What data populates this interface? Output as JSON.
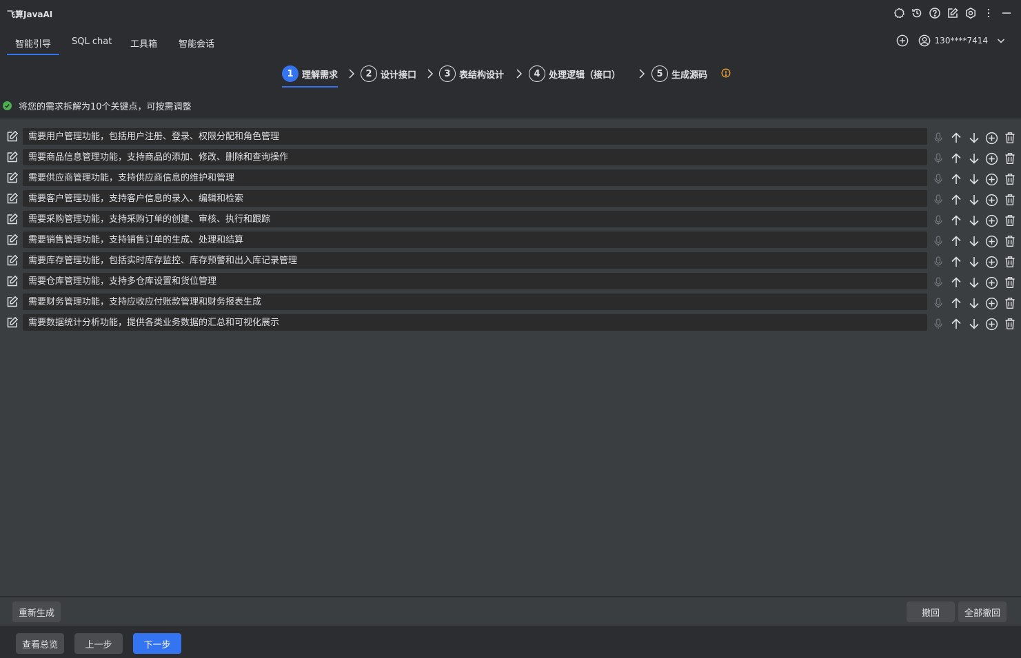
{
  "app": {
    "title": "飞算JavaAI"
  },
  "tabs": [
    {
      "label": "智能引导",
      "active": true
    },
    {
      "label": "SQL chat"
    },
    {
      "label": "工具箱"
    },
    {
      "label": "智能会话"
    }
  ],
  "user": {
    "name": "130****7414"
  },
  "steps": [
    {
      "num": "1",
      "label": "理解需求",
      "active": true
    },
    {
      "num": "2",
      "label": "设计接口"
    },
    {
      "num": "3",
      "label": "表结构设计"
    },
    {
      "num": "4",
      "label": "处理逻辑（接口）"
    },
    {
      "num": "5",
      "label": "生成源码"
    }
  ],
  "hint": "将您的需求拆解为10个关键点，可按需调整",
  "requirements": [
    "需要用户管理功能，包括用户注册、登录、权限分配和角色管理",
    "需要商品信息管理功能，支持商品的添加、修改、删除和查询操作",
    "需要供应商管理功能，支持供应商信息的维护和管理",
    "需要客户管理功能，支持客户信息的录入、编辑和检索",
    "需要采购管理功能，支持采购订单的创建、审核、执行和跟踪",
    "需要销售管理功能，支持销售订单的生成、处理和结算",
    "需要库存管理功能，包括实时库存监控、库存预警和出入库记录管理",
    "需要仓库管理功能，支持多仓库设置和货位管理",
    "需要财务管理功能，支持应收应付账款管理和财务报表生成",
    "需要数据统计分析功能，提供各类业务数据的汇总和可视化展示"
  ],
  "buttons": {
    "regenerate": "重新生成",
    "undo": "撤回",
    "undo_all": "全部撤回",
    "overview": "查看总览",
    "prev": "上一步",
    "next": "下一步"
  },
  "colors": {
    "accent": "#3574f0",
    "success": "#4caf50",
    "warning": "#f0a732"
  }
}
